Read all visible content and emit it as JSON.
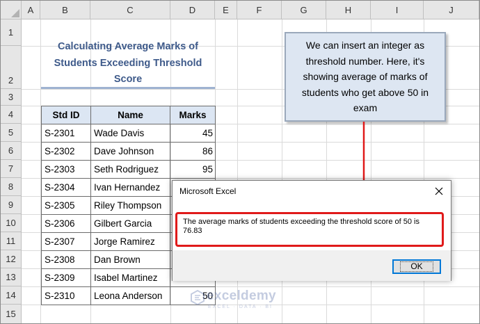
{
  "columns": [
    "A",
    "B",
    "C",
    "D",
    "E",
    "F",
    "G",
    "H",
    "I",
    "J"
  ],
  "rows": [
    "1",
    "2",
    "3",
    "4",
    "5",
    "6",
    "7",
    "8",
    "9",
    "10",
    "11",
    "12",
    "13",
    "14",
    "15"
  ],
  "title": "Calculating Average Marks of Students Exceeding Threshold Score",
  "table": {
    "headers": [
      "Std ID",
      "Name",
      "Marks"
    ],
    "rows": [
      {
        "id": "S-2301",
        "name": "Wade Davis",
        "marks": "45"
      },
      {
        "id": "S-2302",
        "name": "Dave Johnson",
        "marks": "86"
      },
      {
        "id": "S-2303",
        "name": "Seth Rodriguez",
        "marks": "95"
      },
      {
        "id": "S-2304",
        "name": "Ivan Hernandez",
        "marks": ""
      },
      {
        "id": "S-2305",
        "name": "Riley Thompson",
        "marks": ""
      },
      {
        "id": "S-2306",
        "name": "Gilbert Garcia",
        "marks": ""
      },
      {
        "id": "S-2307",
        "name": "Jorge Ramirez",
        "marks": ""
      },
      {
        "id": "S-2308",
        "name": "Dan Brown",
        "marks": ""
      },
      {
        "id": "S-2309",
        "name": "Isabel Martinez",
        "marks": ""
      },
      {
        "id": "S-2310",
        "name": "Leona Anderson",
        "marks": "50"
      }
    ]
  },
  "callout": {
    "text": "We can insert an integer as threshold number. Here, it's showing average of marks of students who get above 50 in exam"
  },
  "dialog": {
    "title": "Microsoft Excel",
    "message": "The average marks of students exceeding the threshold score of 50 is 76.83",
    "ok_label": "OK"
  },
  "watermark": {
    "name": "exceldemy",
    "tagline": "EXCEL · DATA · BI"
  },
  "colors": {
    "title": "#3e5a8a",
    "header_fill": "#dce6f3",
    "callout_fill": "#dde6f2",
    "highlight_red": "#e01a1a",
    "ok_border": "#0078d7"
  }
}
